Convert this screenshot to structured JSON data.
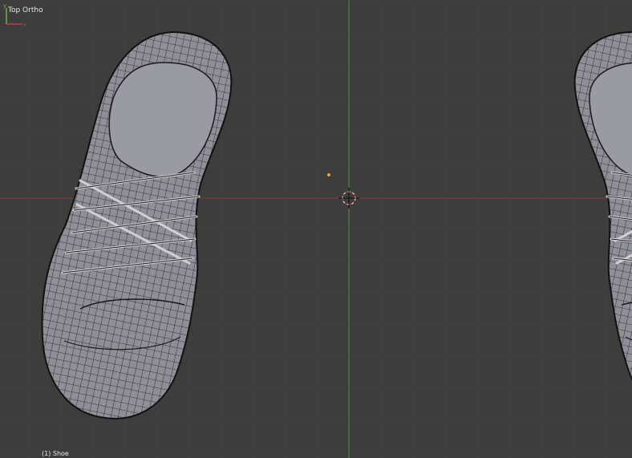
{
  "viewport": {
    "view_label": "Top Ortho",
    "object_label": "(1) Shoe",
    "background": "#3d3d3d",
    "grid_color": "#474747",
    "x_axis_color": "#8a3b3b",
    "y_axis_color": "#5a8a2e"
  },
  "scene": {
    "objects": [
      {
        "name": "shoe-left",
        "type": "mesh"
      },
      {
        "name": "shoe-right",
        "type": "mesh"
      }
    ],
    "cursor_icon": "3d-cursor-icon",
    "origin_icon": "object-origin-icon",
    "gizmo_icon": "axis-gizmo-icon"
  }
}
